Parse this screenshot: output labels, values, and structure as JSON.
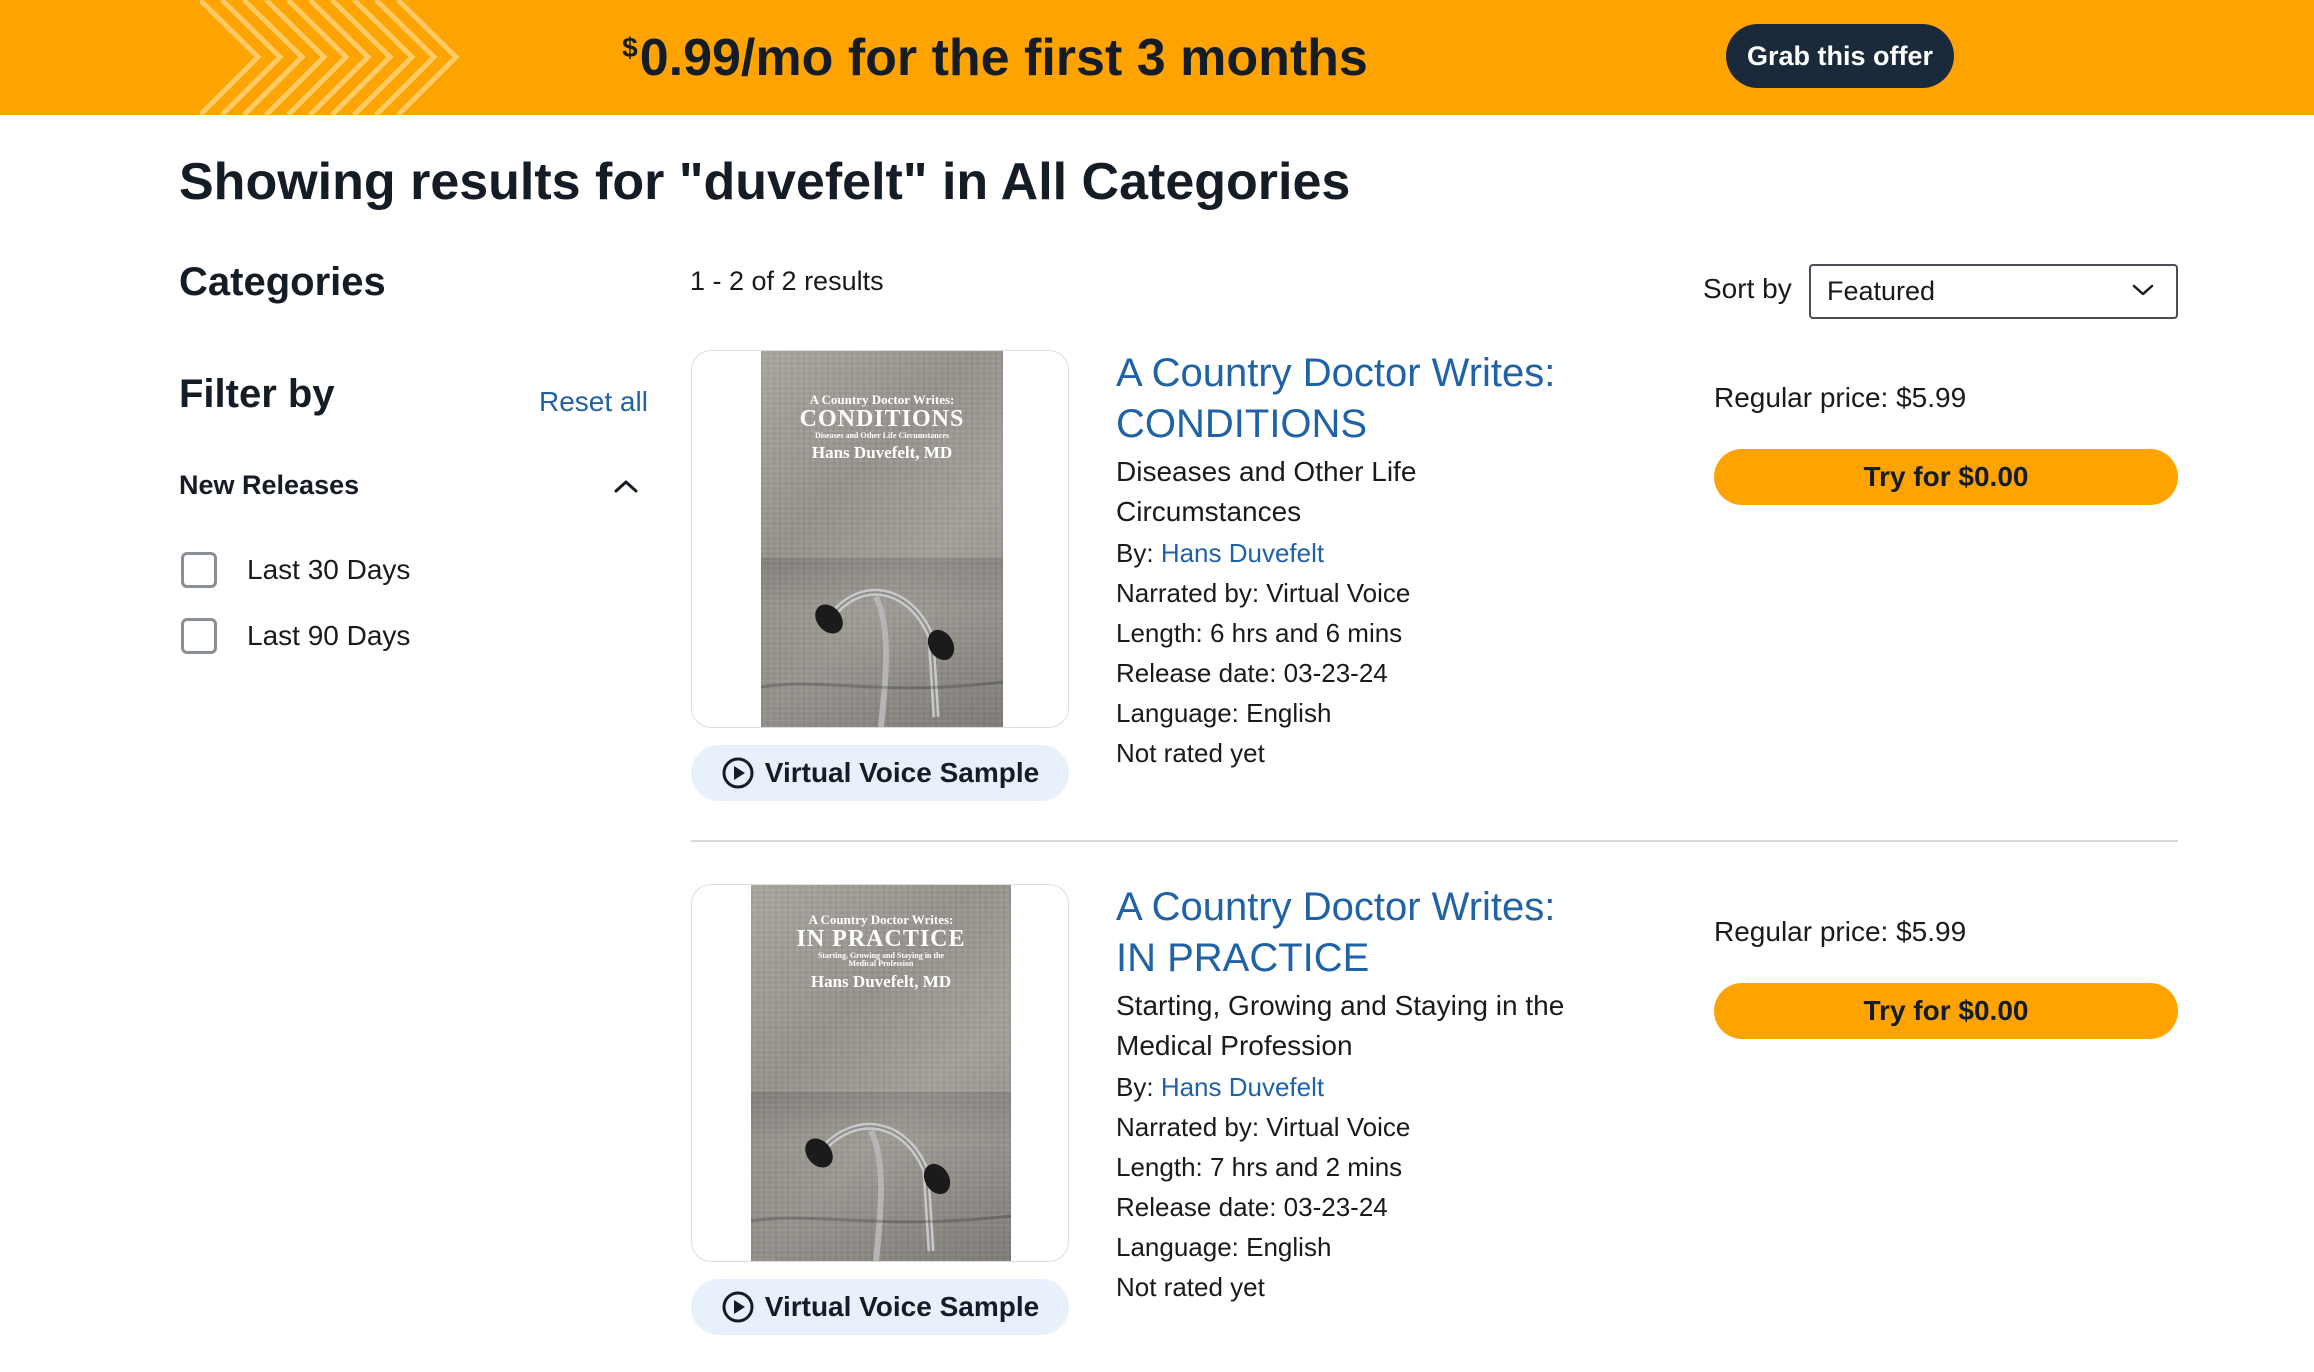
{
  "banner": {
    "currency": "$",
    "offer_text": "0.99/mo for the first 3 months",
    "button_label": "Grab this offer",
    "bg_color": "#ffa300"
  },
  "page": {
    "heading": "Showing results for \"duvefelt\" in All Categories"
  },
  "sidebar": {
    "categories_heading": "Categories",
    "filter_heading": "Filter by",
    "reset_label": "Reset all",
    "section_title": "New Releases",
    "section_icon": "chevron-up-icon",
    "options": [
      {
        "label": "Last 30 Days",
        "checked": false
      },
      {
        "label": "Last 90 Days",
        "checked": false
      }
    ]
  },
  "results_header": {
    "count": "1 - 2 of 2 results",
    "sort_label": "Sort by",
    "sort_value": "Featured"
  },
  "results": [
    {
      "title_line1": "A Country Doctor Writes:",
      "title_line2": "CONDITIONS",
      "subtitle": "Diseases and Other Life Circumstances",
      "by_label": "By:",
      "author": "Hans Duvefelt",
      "narrated": "Narrated by: Virtual Voice",
      "length": "Length: 6 hrs and 6 mins",
      "release": "Release date: 03-23-24",
      "language": "Language: English",
      "rating": "Not rated yet",
      "price": "Regular price: $5.99",
      "try_label": "Try for $0.00",
      "sample_label": "Virtual Voice Sample",
      "cover": {
        "line1": "A Country Doctor Writes:",
        "line2": "CONDITIONS",
        "line3": "Diseases and Other Life Circumstances",
        "line4": "Hans Duvefelt, MD"
      }
    },
    {
      "title_line1": "A Country Doctor Writes:",
      "title_line2": "IN PRACTICE",
      "subtitle": "Starting, Growing and Staying in the Medical Profession",
      "by_label": "By:",
      "author": "Hans Duvefelt",
      "narrated": "Narrated by: Virtual Voice",
      "length": "Length: 7 hrs and 2 mins",
      "release": "Release date: 03-23-24",
      "language": "Language: English",
      "rating": "Not rated yet",
      "price": "Regular price: $5.99",
      "try_label": "Try for $0.00",
      "sample_label": "Virtual Voice Sample",
      "cover": {
        "line1": "A Country Doctor Writes:",
        "line2": "IN PRACTICE",
        "line3": "Starting, Growing and Staying in the Medical Profession",
        "line4": "Hans Duvefelt, MD"
      }
    }
  ]
}
